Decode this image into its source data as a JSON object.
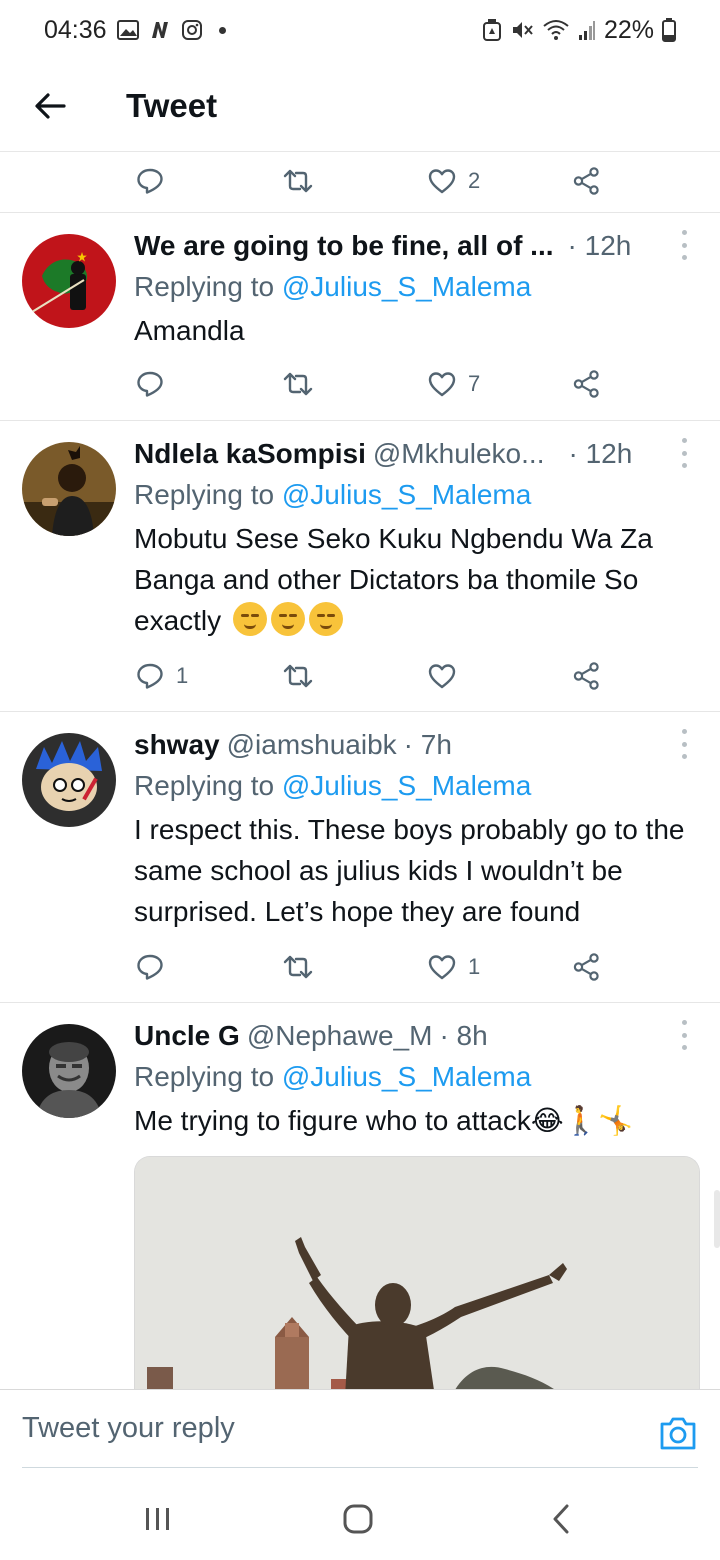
{
  "status_bar": {
    "time": "04:36",
    "battery": "22%"
  },
  "header": {
    "title": "Tweet"
  },
  "top_actions": {
    "like_count": "2"
  },
  "tweets": [
    {
      "name": "We are going to be fine, all of ...",
      "handle": "",
      "time": "· 12h",
      "replying_prefix": "Replying to ",
      "replying_to": "@Julius_S_Malema",
      "text": "Amandla",
      "reply_count": "",
      "like_count": "7"
    },
    {
      "name": "Ndlela kaSompisi",
      "handle": "@Mkhuleko...",
      "time": "· 12h",
      "replying_prefix": "Replying to ",
      "replying_to": "@Julius_S_Malema",
      "text": "Mobutu Sese Seko Kuku Ngbendu Wa Za Banga and other Dictators ba thomile So exactly",
      "reply_count": "1",
      "like_count": ""
    },
    {
      "name": "shway",
      "handle": "@iamshuaibk",
      "time": "· 7h",
      "replying_prefix": "Replying to ",
      "replying_to": "@Julius_S_Malema",
      "text": "I respect this. These boys probably go to the same school as julius kids I wouldn’t be surprised. Let’s hope they are found",
      "reply_count": "",
      "like_count": "1"
    },
    {
      "name": "Uncle G",
      "handle": "@Nephawe_M",
      "time": "· 8h",
      "replying_prefix": "Replying to ",
      "replying_to": "@Julius_S_Malema",
      "text": "Me trying to figure who to attack😂🚶🤸",
      "reply_count": "",
      "like_count": ""
    }
  ],
  "reply_bar": {
    "placeholder": "Tweet your reply"
  },
  "colors": {
    "accent": "#1d9bf0",
    "secondary_text": "#536471",
    "primary_text": "#0f1419"
  },
  "icons": [
    "back-arrow-icon",
    "reply-icon",
    "retweet-icon",
    "like-icon",
    "share-icon",
    "more-icon",
    "camera-icon"
  ]
}
